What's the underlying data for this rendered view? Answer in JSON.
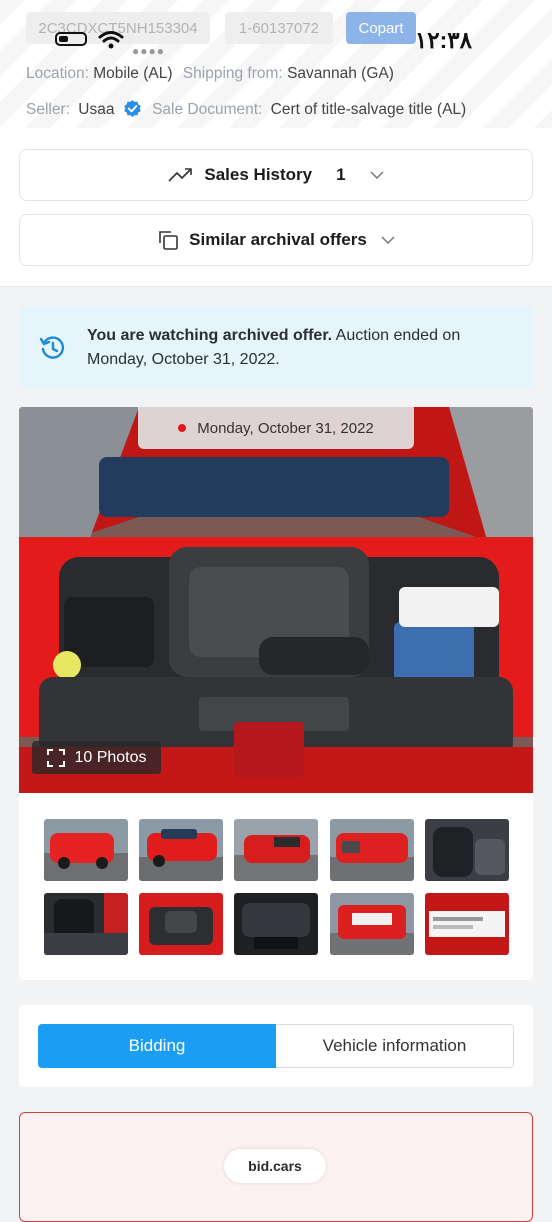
{
  "status_bar": {
    "time": "۱۲:۳۸"
  },
  "header": {
    "vin": "2C3CDXCT5NH153304",
    "lot": "1-60137072",
    "auction": "Copart",
    "location_label": "Location:",
    "location_value": "Mobile (AL)",
    "shipping_label": "Shipping from:",
    "shipping_value": "Savannah (GA)",
    "seller_label": "Seller:",
    "seller_value": "Usaa",
    "document_label": "Sale Document:",
    "document_value": "Cert of title-salvage title (AL)"
  },
  "sales_history": {
    "label": "Sales History",
    "count": "1"
  },
  "similar_offers": {
    "label": "Similar archival offers"
  },
  "notice": {
    "bold": "You are watching archived offer.",
    "rest": " Auction ended on Monday, October 31, 2022."
  },
  "gallery": {
    "date": "Monday, October 31, 2022",
    "photos_label": "10 Photos"
  },
  "tabs": {
    "bidding": "Bidding",
    "vehicle_info": "Vehicle information"
  },
  "footer": {
    "badge": "bid.cars"
  },
  "colors": {
    "accent": "#1a9df2",
    "copart": "#8db4e9",
    "notice_bg": "#e6f4fc",
    "alert_border": "#d9403a"
  }
}
